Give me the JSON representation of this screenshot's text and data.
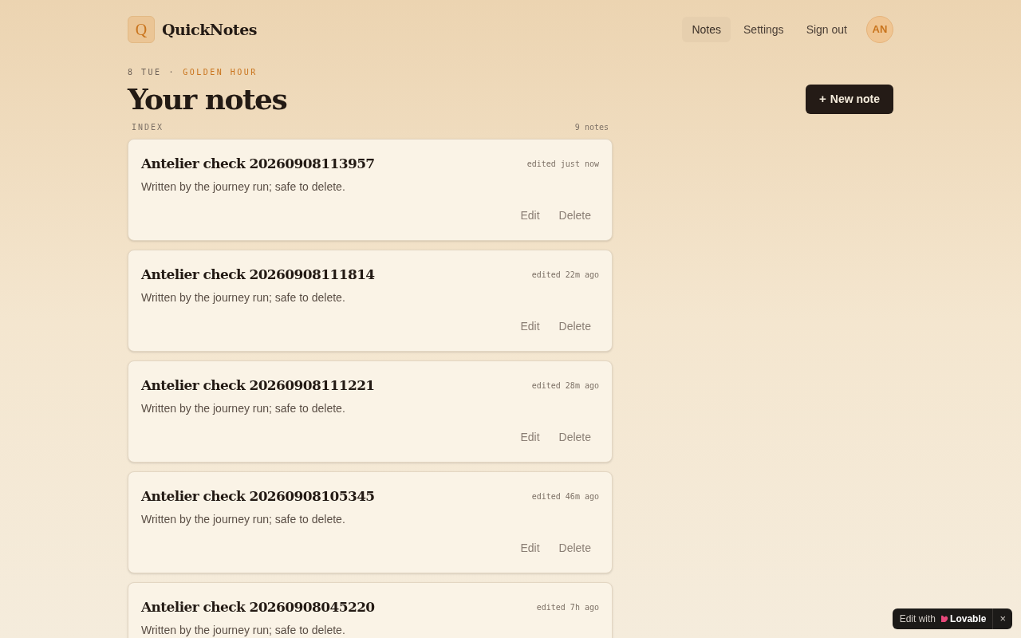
{
  "brand": {
    "logo_letter": "Q",
    "name": "QuickNotes"
  },
  "nav": [
    {
      "label": "Notes",
      "selected": true
    },
    {
      "label": "Settings",
      "selected": false
    },
    {
      "label": "Sign out",
      "selected": false
    }
  ],
  "avatar": "AN",
  "dateline": {
    "date": "8 TUE",
    "separator": "·",
    "mood": "GOLDEN HOUR"
  },
  "title": "Your notes",
  "new_button": {
    "icon": "+",
    "label": "New note"
  },
  "index": {
    "label": "INDEX",
    "count": "9 notes"
  },
  "notes": [
    {
      "title": "Antelier check 20260908113957",
      "edited": "edited just now",
      "body": "Written by the journey run; safe to delete.",
      "actions": [
        "Edit",
        "Delete"
      ]
    },
    {
      "title": "Antelier check 20260908111814",
      "edited": "edited 22m ago",
      "body": "Written by the journey run; safe to delete.",
      "actions": [
        "Edit",
        "Delete"
      ]
    },
    {
      "title": "Antelier check 20260908111221",
      "edited": "edited 28m ago",
      "body": "Written by the journey run; safe to delete.",
      "actions": [
        "Edit",
        "Delete"
      ]
    },
    {
      "title": "Antelier check 20260908105345",
      "edited": "edited 46m ago",
      "body": "Written by the journey run; safe to delete.",
      "actions": [
        "Edit",
        "Delete"
      ]
    },
    {
      "title": "Antelier check 20260908045220",
      "edited": "edited 7h ago",
      "body": "Written by the journey run; safe to delete."
    }
  ],
  "badge": {
    "prefix": "Edit with",
    "brand": "Lovable",
    "close": "×"
  }
}
